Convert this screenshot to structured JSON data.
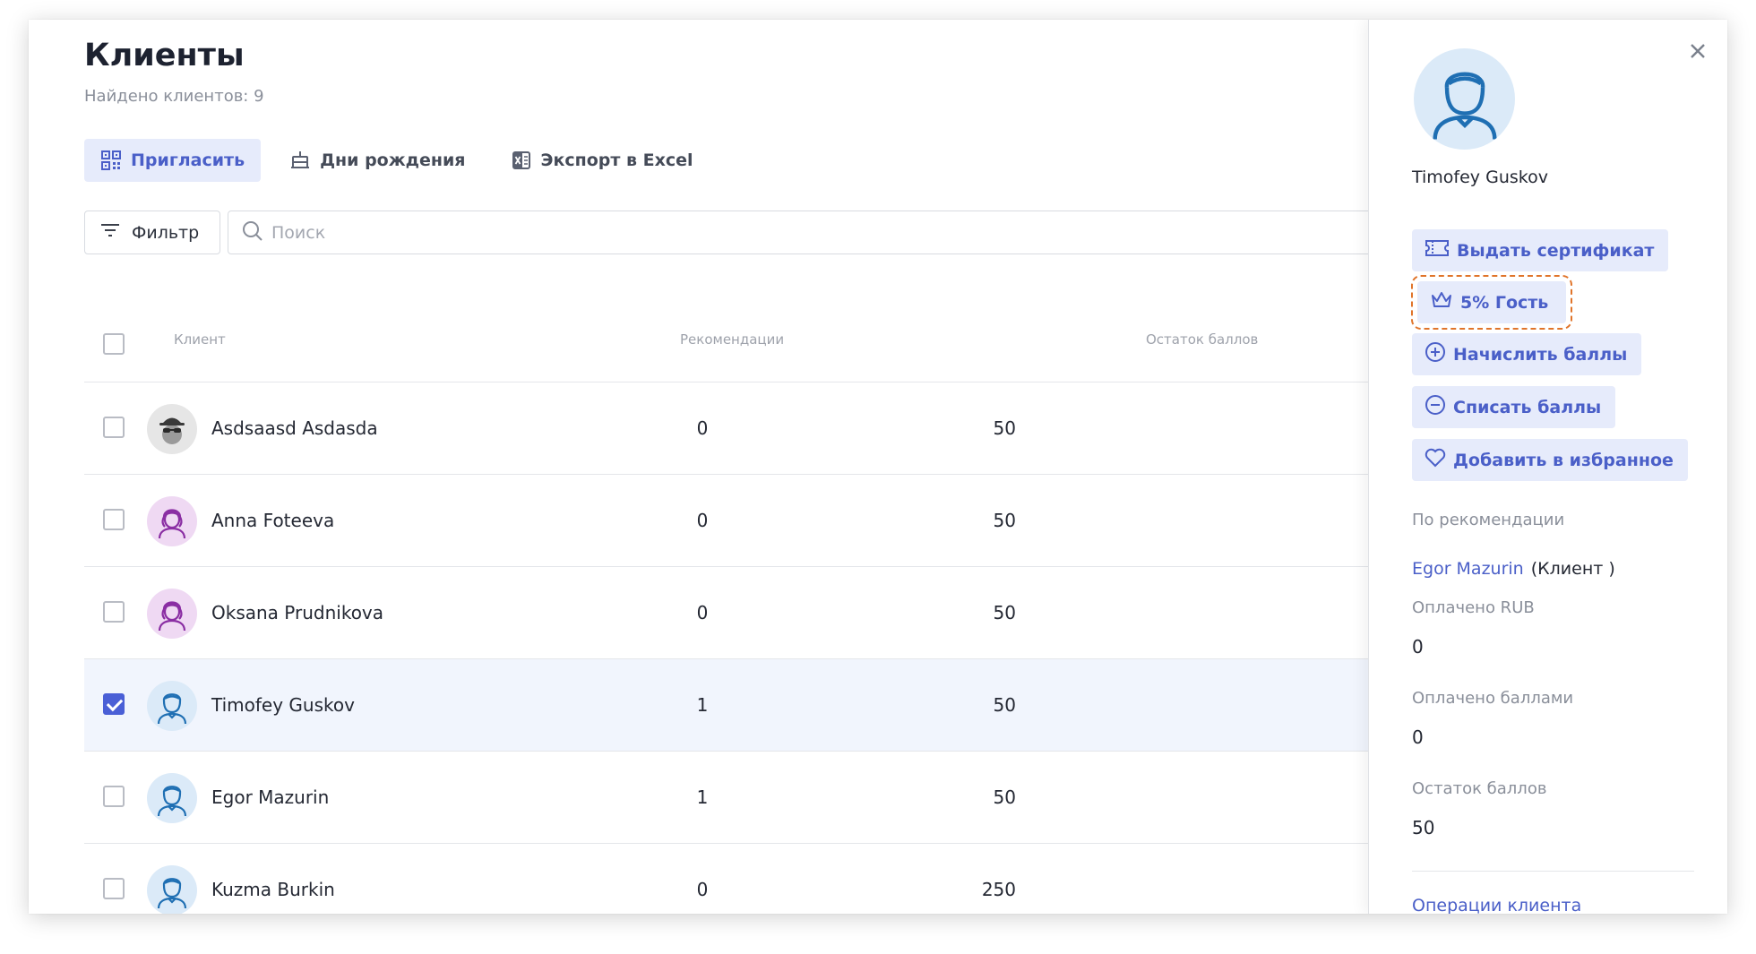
{
  "page": {
    "title": "Клиенты",
    "subtitle": "Найдено клиентов: 9"
  },
  "toolbar": {
    "invite_label": "Пригласить",
    "birthdays_label": "Дни рождения",
    "export_label": "Экспорт в Excel"
  },
  "filter": {
    "label": "Фильтр"
  },
  "search": {
    "placeholder": "Поиск",
    "value": ""
  },
  "table": {
    "columns": {
      "client": "Клиент",
      "recommendations": "Рекомендации",
      "balance": "Остаток баллов"
    },
    "rows": [
      {
        "name": "Asdsaasd Asdasda",
        "recommendations": "0",
        "balance": "50",
        "avatar": "incognito-avatar",
        "checked": false
      },
      {
        "name": "Anna Foteeva",
        "recommendations": "0",
        "balance": "50",
        "avatar": "female-avatar",
        "checked": false
      },
      {
        "name": "Oksana Prudnikova",
        "recommendations": "0",
        "balance": "50",
        "avatar": "female-avatar",
        "checked": false
      },
      {
        "name": "Timofey Guskov",
        "recommendations": "1",
        "balance": "50",
        "avatar": "male-avatar",
        "checked": true
      },
      {
        "name": "Egor Mazurin",
        "recommendations": "1",
        "balance": "50",
        "avatar": "male-avatar",
        "checked": false
      },
      {
        "name": "Kuzma Burkin",
        "recommendations": "0",
        "balance": "250",
        "avatar": "male-avatar",
        "checked": false
      }
    ]
  },
  "panel": {
    "name": "Timofey Guskov",
    "actions": {
      "certificate": "Выдать сертификат",
      "level": "5% Гость",
      "accrue": "Начислить баллы",
      "deduct": "Списать баллы",
      "favorite": "Добавить в избранное"
    },
    "referral_label": "По рекомендации",
    "referral_name": "Egor Mazurin",
    "referral_role": "(Клиент )",
    "paid_rub_label": "Оплачено RUB",
    "paid_rub_value": "0",
    "paid_points_label": "Оплачено баллами",
    "paid_points_value": "0",
    "balance_label": "Остаток баллов",
    "balance_value": "50",
    "operations_link": "Операции клиента"
  },
  "colors": {
    "accent": "#4a5fc8",
    "accent_bg": "#e6ebfb",
    "highlight_outline": "#e0742a",
    "selected_row": "#f1f5fd"
  }
}
